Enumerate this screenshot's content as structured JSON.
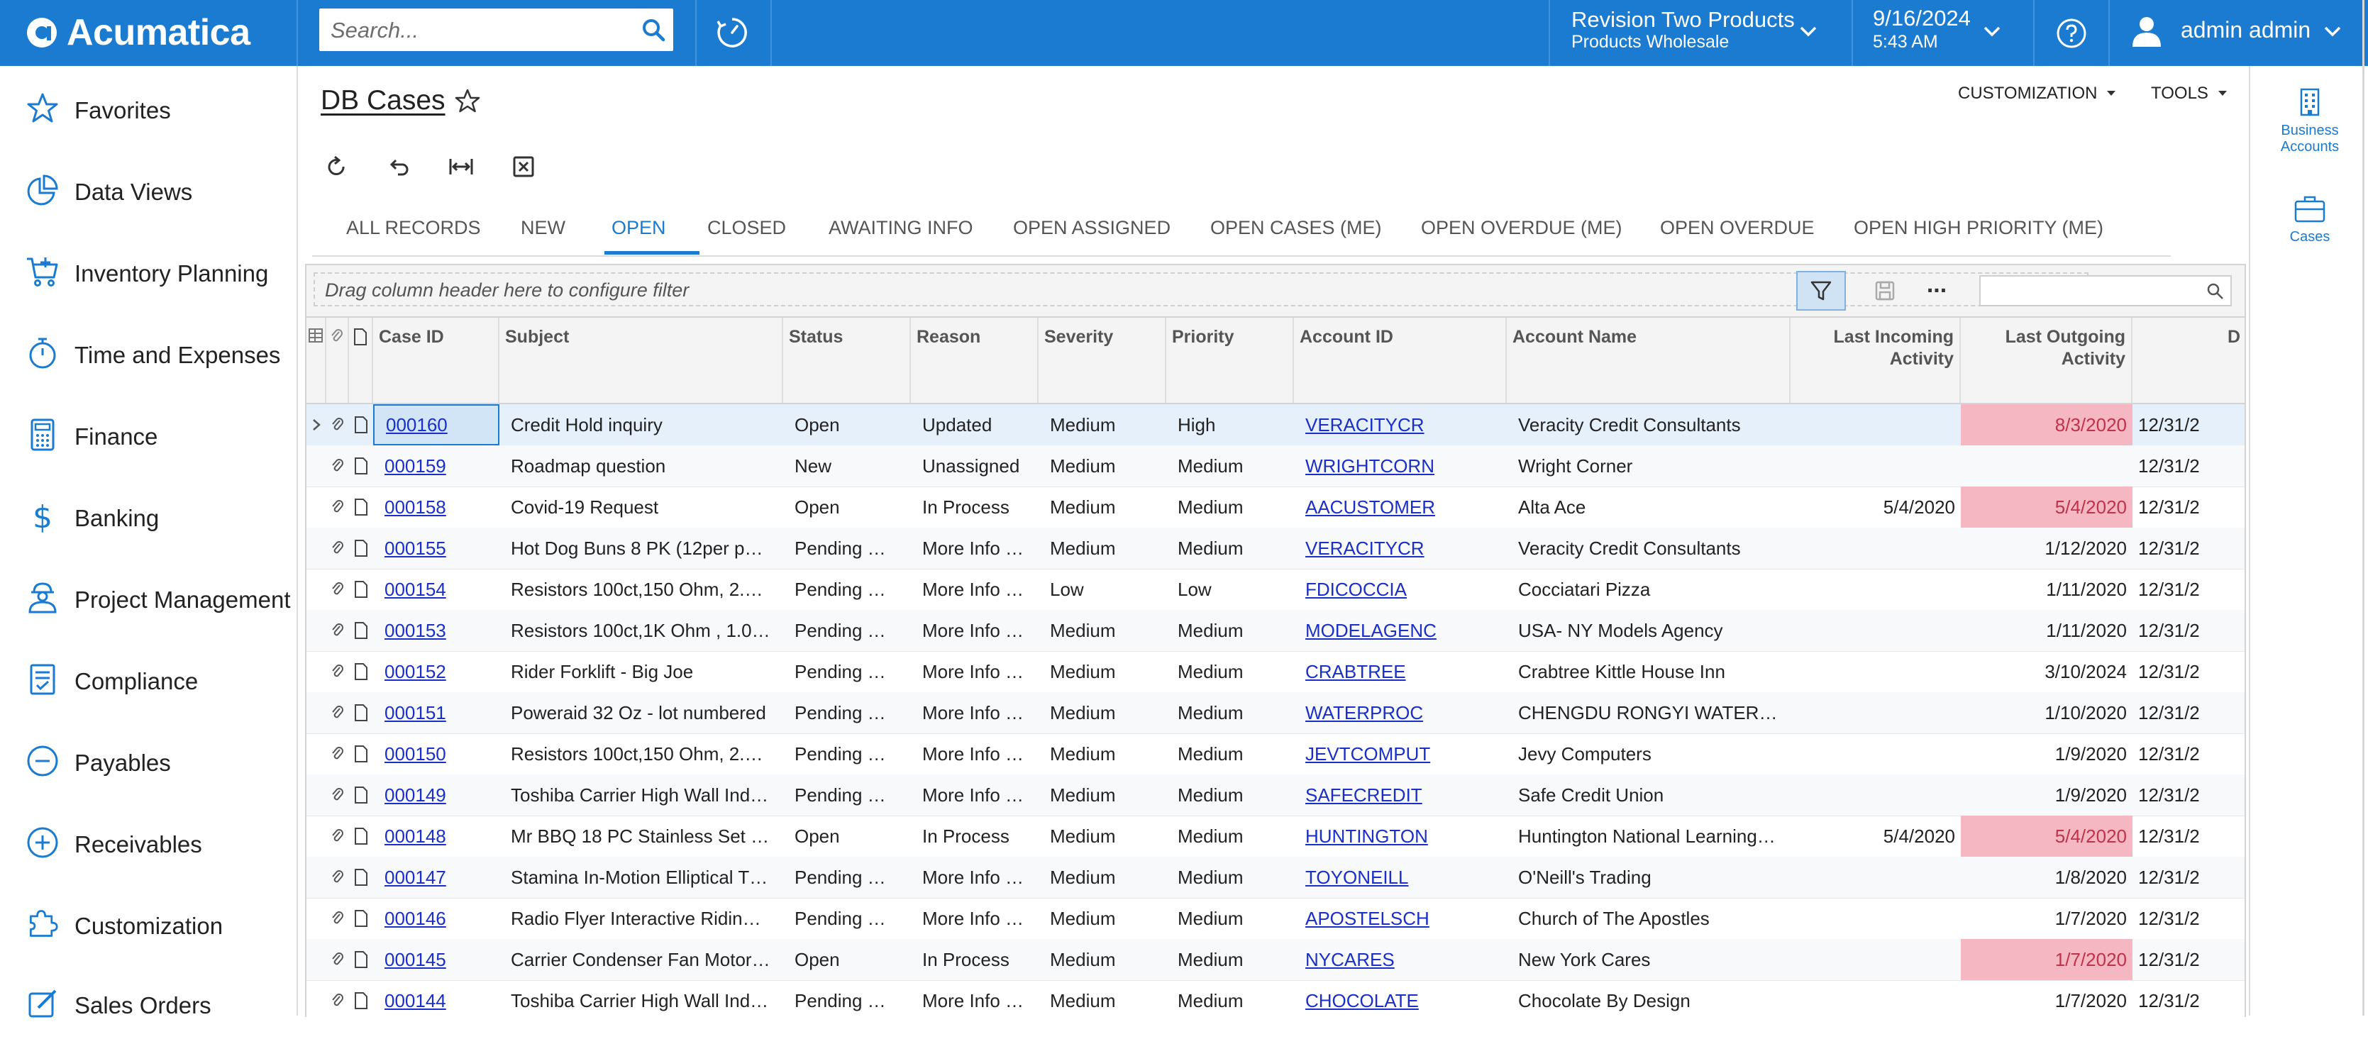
{
  "app": {
    "logo_text": "Acumatica"
  },
  "topbar": {
    "search_placeholder": "Search...",
    "company_name": "Revision Two Products",
    "company_branch": "Products Wholesale",
    "date": "9/16/2024",
    "time": "5:43 AM",
    "user_name": "admin admin"
  },
  "sidebar": {
    "items": [
      {
        "label": "Favorites",
        "icon": "star-icon"
      },
      {
        "label": "Data Views",
        "icon": "pie-chart-icon"
      },
      {
        "label": "Inventory Planning",
        "icon": "cart-icon"
      },
      {
        "label": "Time and Expenses",
        "icon": "stopwatch-icon"
      },
      {
        "label": "Finance",
        "icon": "calculator-icon"
      },
      {
        "label": "Banking",
        "icon": "dollar-icon"
      },
      {
        "label": "Project Management",
        "icon": "worker-icon"
      },
      {
        "label": "Compliance",
        "icon": "checklist-icon"
      },
      {
        "label": "Payables",
        "icon": "minus-circle-icon"
      },
      {
        "label": "Receivables",
        "icon": "plus-circle-icon"
      },
      {
        "label": "Customization",
        "icon": "puzzle-icon"
      },
      {
        "label": "Sales Orders",
        "icon": "pencil-icon"
      }
    ]
  },
  "right_panel": {
    "business_accounts": "Business Accounts",
    "cases": "Cases"
  },
  "page": {
    "title": "DB Cases",
    "customization_menu": "CUSTOMIZATION",
    "tools_menu": "TOOLS"
  },
  "tabs": [
    "ALL RECORDS",
    "NEW",
    "OPEN",
    "CLOSED",
    "AWAITING INFO",
    "OPEN ASSIGNED",
    "OPEN CASES (ME)",
    "OPEN OVERDUE (ME)",
    "OPEN OVERDUE",
    "OPEN HIGH PRIORITY (ME)"
  ],
  "active_tab": "OPEN",
  "filter": {
    "placeholder": "Drag column header here to configure filter",
    "more_label": "..."
  },
  "grid": {
    "columns": {
      "case_id": "Case ID",
      "subject": "Subject",
      "status": "Status",
      "reason": "Reason",
      "severity": "Severity",
      "priority": "Priority",
      "account_id": "Account ID",
      "account_name": "Account Name",
      "last_incoming": "Last Incoming Activity",
      "last_outgoing": "Last Outgoing Activity",
      "next": "D"
    },
    "rows": [
      {
        "case_id": "000160",
        "subject": "Credit Hold inquiry",
        "status": "Open",
        "reason": "Updated",
        "severity": "Medium",
        "priority": "High",
        "account_id": "VERACITYCR",
        "account_name": "Veracity Credit Consultants",
        "last_incoming": "",
        "last_outgoing": "8/3/2020",
        "next": "12/31/2",
        "out_hl": true
      },
      {
        "case_id": "000159",
        "subject": "Roadmap question",
        "status": "New",
        "reason": "Unassigned",
        "severity": "Medium",
        "priority": "Medium",
        "account_id": "WRIGHTCORN",
        "account_name": "Wright Corner",
        "last_incoming": "",
        "last_outgoing": "",
        "next": "12/31/2",
        "out_hl": false
      },
      {
        "case_id": "000158",
        "subject": "Covid-19 Request",
        "status": "Open",
        "reason": "In Process",
        "severity": "Medium",
        "priority": "Medium",
        "account_id": "AACUSTOMER",
        "account_name": "Alta Ace",
        "last_incoming": "5/4/2020",
        "last_outgoing": "5/4/2020",
        "next": "12/31/2",
        "out_hl": true
      },
      {
        "case_id": "000155",
        "subject": "Hot Dog Buns 8 PK (12per p…",
        "status": "Pending …",
        "reason": "More Info …",
        "severity": "Medium",
        "priority": "Medium",
        "account_id": "VERACITYCR",
        "account_name": "Veracity Credit Consultants",
        "last_incoming": "",
        "last_outgoing": "1/12/2020",
        "next": "12/31/2",
        "out_hl": false
      },
      {
        "case_id": "000154",
        "subject": "Resistors 100ct,150 Ohm, 2.…",
        "status": "Pending …",
        "reason": "More Info …",
        "severity": "Low",
        "priority": "Low",
        "account_id": "FDICOCCIA",
        "account_name": "Cocciatari Pizza",
        "last_incoming": "",
        "last_outgoing": "1/11/2020",
        "next": "12/31/2",
        "out_hl": false
      },
      {
        "case_id": "000153",
        "subject": "Resistors 100ct,1K Ohm , 1.0…",
        "status": "Pending …",
        "reason": "More Info …",
        "severity": "Medium",
        "priority": "Medium",
        "account_id": "MODELAGENC",
        "account_name": "USA- NY Models Agency",
        "last_incoming": "",
        "last_outgoing": "1/11/2020",
        "next": "12/31/2",
        "out_hl": false
      },
      {
        "case_id": "000152",
        "subject": "Rider Forklift - Big Joe",
        "status": "Pending …",
        "reason": "More Info …",
        "severity": "Medium",
        "priority": "Medium",
        "account_id": "CRABTREE",
        "account_name": "Crabtree Kittle House Inn",
        "last_incoming": "",
        "last_outgoing": "3/10/2024",
        "next": "12/31/2",
        "out_hl": false
      },
      {
        "case_id": "000151",
        "subject": "Poweraid 32 Oz - lot numbered",
        "status": "Pending …",
        "reason": "More Info …",
        "severity": "Medium",
        "priority": "Medium",
        "account_id": "WATERPROC",
        "account_name": "CHENGDU RONGYI WATER…",
        "last_incoming": "",
        "last_outgoing": "1/10/2020",
        "next": "12/31/2",
        "out_hl": false
      },
      {
        "case_id": "000150",
        "subject": "Resistors 100ct,150 Ohm, 2.…",
        "status": "Pending …",
        "reason": "More Info …",
        "severity": "Medium",
        "priority": "Medium",
        "account_id": "JEVTCOMPUT",
        "account_name": "Jevy Computers",
        "last_incoming": "",
        "last_outgoing": "1/9/2020",
        "next": "12/31/2",
        "out_hl": false
      },
      {
        "case_id": "000149",
        "subject": "Toshiba Carrier High Wall Ind…",
        "status": "Pending …",
        "reason": "More Info …",
        "severity": "Medium",
        "priority": "Medium",
        "account_id": "SAFECREDIT",
        "account_name": "Safe Credit Union",
        "last_incoming": "",
        "last_outgoing": "1/9/2020",
        "next": "12/31/2",
        "out_hl": false
      },
      {
        "case_id": "000148",
        "subject": "Mr BBQ 18 PC Stainless Set …",
        "status": "Open",
        "reason": "In Process",
        "severity": "Medium",
        "priority": "Medium",
        "account_id": "HUNTINGTON",
        "account_name": "Huntington National Learning…",
        "last_incoming": "5/4/2020",
        "last_outgoing": "5/4/2020",
        "next": "12/31/2",
        "out_hl": true
      },
      {
        "case_id": "000147",
        "subject": "Stamina In-Motion Elliptical T…",
        "status": "Pending …",
        "reason": "More Info …",
        "severity": "Medium",
        "priority": "Medium",
        "account_id": "TOYONEILL",
        "account_name": "O'Neill's Trading",
        "last_incoming": "",
        "last_outgoing": "1/8/2020",
        "next": "12/31/2",
        "out_hl": false
      },
      {
        "case_id": "000146",
        "subject": "Radio Flyer Interactive Ridin…",
        "status": "Pending …",
        "reason": "More Info …",
        "severity": "Medium",
        "priority": "Medium",
        "account_id": "APOSTELSCH",
        "account_name": "Church of The Apostles",
        "last_incoming": "",
        "last_outgoing": "1/7/2020",
        "next": "12/31/2",
        "out_hl": false
      },
      {
        "case_id": "000145",
        "subject": "Carrier Condenser Fan Motor…",
        "status": "Open",
        "reason": "In Process",
        "severity": "Medium",
        "priority": "Medium",
        "account_id": "NYCARES",
        "account_name": "New York Cares",
        "last_incoming": "",
        "last_outgoing": "1/7/2020",
        "next": "12/31/2",
        "out_hl": true
      },
      {
        "case_id": "000144",
        "subject": "Toshiba Carrier High Wall Ind…",
        "status": "Pending …",
        "reason": "More Info …",
        "severity": "Medium",
        "priority": "Medium",
        "account_id": "CHOCOLATE",
        "account_name": "Chocolate By Design",
        "last_incoming": "",
        "last_outgoing": "1/7/2020",
        "next": "12/31/2",
        "out_hl": false
      }
    ]
  },
  "colors": {
    "brand_blue": "#1a7bd0",
    "link_blue": "#1a2fc9",
    "highlight_pink": "#f5b8c3",
    "highlight_text": "#c0324a"
  }
}
